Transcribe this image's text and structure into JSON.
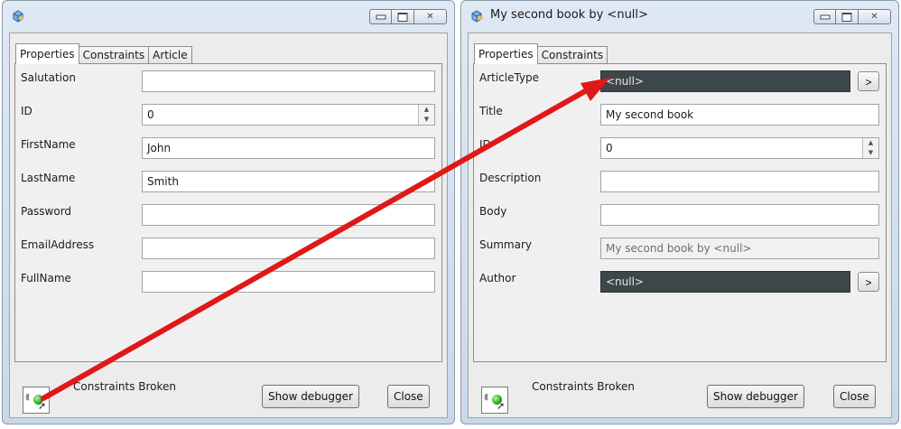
{
  "window1": {
    "title": "",
    "tabs": [
      "Properties",
      "Constraints",
      "Article"
    ],
    "active_tab": "Properties",
    "fields": [
      {
        "label": "Salutation",
        "value": ""
      },
      {
        "label": "ID",
        "value": "0"
      },
      {
        "label": "FirstName",
        "value": "John"
      },
      {
        "label": "LastName",
        "value": "Smith"
      },
      {
        "label": "Password",
        "value": ""
      },
      {
        "label": "EmailAddress",
        "value": ""
      },
      {
        "label": "FullName",
        "value": ""
      }
    ],
    "status": "Constraints Broken",
    "debugger_button": "Show debugger",
    "close_button": "Close"
  },
  "window2": {
    "title": "My second book by <null>",
    "tabs": [
      "Properties",
      "Constraints"
    ],
    "active_tab": "Properties",
    "fields": [
      {
        "label": "ArticleType",
        "value": "<null>"
      },
      {
        "label": "Title",
        "value": "My second book"
      },
      {
        "label": "ID",
        "value": "0"
      },
      {
        "label": "Description",
        "value": ""
      },
      {
        "label": "Body",
        "value": ""
      },
      {
        "label": "Summary",
        "value": "My second book by <null>"
      },
      {
        "label": "Author",
        "value": "<null>"
      }
    ],
    "picker_label": ">",
    "status": "Constraints Broken",
    "debugger_button": "Show debugger",
    "close_button": "Close"
  },
  "colors": {
    "arrow": "#e01818",
    "null_field": "#3d4648",
    "led": "#25a51a"
  }
}
